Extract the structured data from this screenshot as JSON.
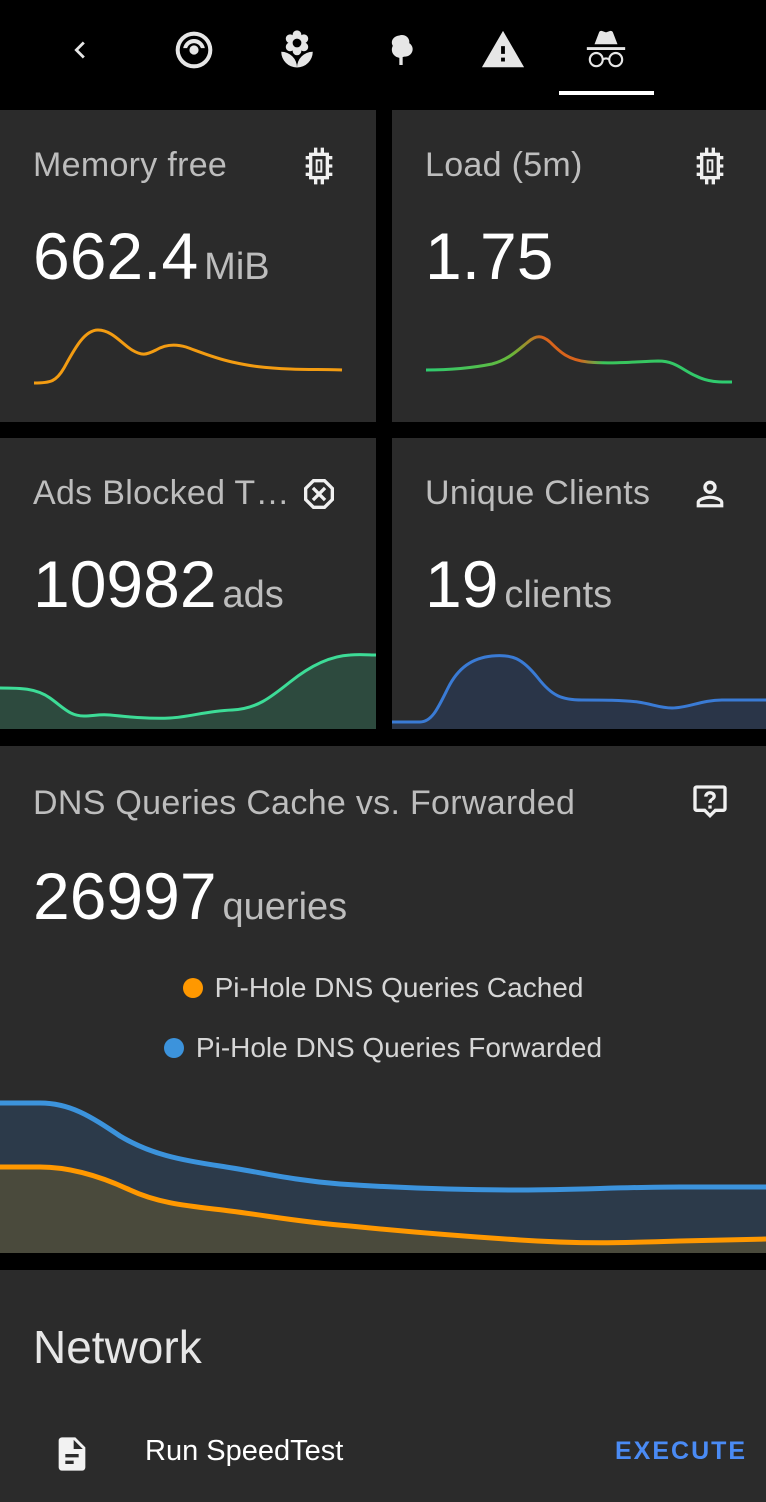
{
  "nav": {
    "items": [
      {
        "icon": "chevron-left-icon"
      },
      {
        "icon": "robot-vacuum-icon"
      },
      {
        "icon": "flower-icon"
      },
      {
        "icon": "tree-icon"
      },
      {
        "icon": "alert-icon"
      },
      {
        "icon": "incognito-icon",
        "active": true
      }
    ]
  },
  "cards": {
    "memory": {
      "title": "Memory free",
      "value": "662.4",
      "unit": "MiB",
      "icon": "chip-icon",
      "color": "#f39c12"
    },
    "load": {
      "title": "Load (5m)",
      "value": "1.75",
      "unit": "",
      "icon": "chip-icon",
      "colors": [
        "#2ecc71",
        "#e67e22"
      ]
    },
    "ads": {
      "title": "Ads Blocked T…",
      "value": "10982",
      "unit": "ads",
      "icon": "close-octagon-icon",
      "color": "#3ddc97"
    },
    "clients": {
      "title": "Unique Clients",
      "value": "19",
      "unit": "clients",
      "icon": "account-icon",
      "color": "#3a7bd5"
    }
  },
  "dns": {
    "title": "DNS Queries Cache vs. Forwarded",
    "value": "26997",
    "unit": "queries",
    "icon": "comment-question-icon",
    "legend": [
      {
        "label": "Pi-Hole DNS Queries Cached",
        "color": "#ff9800"
      },
      {
        "label": "Pi-Hole DNS Queries Forwarded",
        "color": "#3c93dc"
      }
    ]
  },
  "network": {
    "title": "Network",
    "row": {
      "icon": "file-document-icon",
      "label": "Run SpeedTest",
      "action": "EXECUTE"
    }
  }
}
